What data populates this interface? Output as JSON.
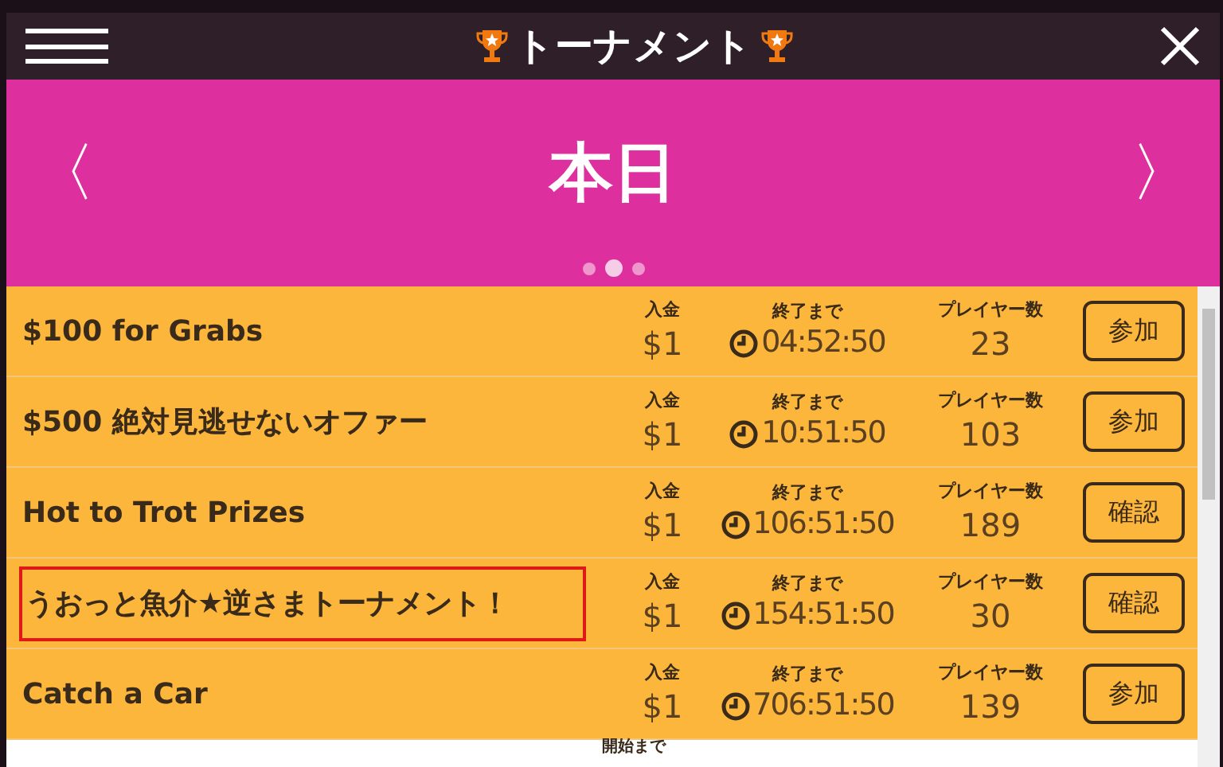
{
  "header": {
    "title": "トーナメント"
  },
  "banner": {
    "prev": "〈",
    "label": "本日",
    "next": "〉",
    "pages": [
      {
        "selected": false
      },
      {
        "selected": true
      },
      {
        "selected": false
      }
    ]
  },
  "rows": [
    {
      "name": "$100 for Grabs",
      "highlighted": false,
      "fee_label": "入金",
      "fee": "$1",
      "time_label": "終了まで",
      "time": "04:52:50",
      "players_label": "プレイヤー数",
      "players": "23",
      "action": "参加"
    },
    {
      "name": "$500 絶対見逃せないオファー",
      "highlighted": false,
      "fee_label": "入金",
      "fee": "$1",
      "time_label": "終了まで",
      "time": "10:51:50",
      "players_label": "プレイヤー数",
      "players": "103",
      "action": "参加"
    },
    {
      "name": "Hot to Trot Prizes",
      "highlighted": false,
      "fee_label": "入金",
      "fee": "$1",
      "time_label": "終了まで",
      "time": "106:51:50",
      "players_label": "プレイヤー数",
      "players": "189",
      "action": "確認"
    },
    {
      "name": "うおっと魚介★逆さまトーナメント！",
      "highlighted": true,
      "fee_label": "入金",
      "fee": "$1",
      "time_label": "終了まで",
      "time": "154:51:50",
      "players_label": "プレイヤー数",
      "players": "30",
      "action": "確認"
    },
    {
      "name": "Catch a Car",
      "highlighted": false,
      "fee_label": "入金",
      "fee": "$1",
      "time_label": "終了まで",
      "time": "706:51:50",
      "players_label": "プレイヤー数",
      "players": "139",
      "action": "参加"
    }
  ],
  "next_row": {
    "time_label": "開始まで"
  }
}
